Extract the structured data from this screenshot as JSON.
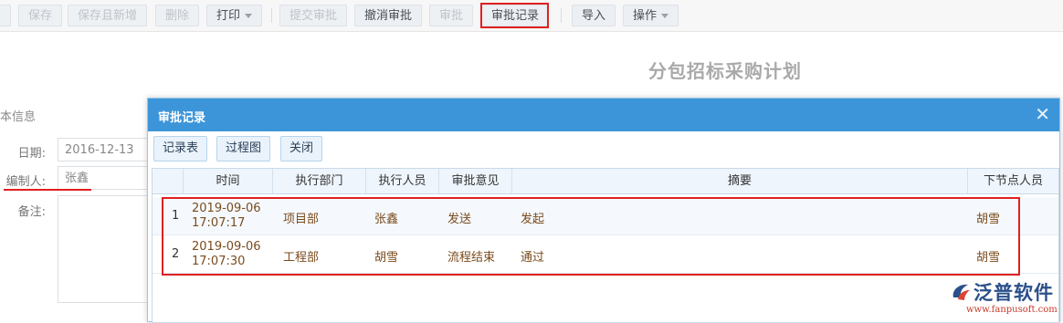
{
  "toolbar": {
    "buttons": [
      {
        "label": "保存"
      },
      {
        "label": "保存且新增"
      },
      {
        "label": "删除"
      },
      {
        "label": "打印"
      },
      {
        "label": "提交审批"
      },
      {
        "label": "撤消审批"
      },
      {
        "label": "审批"
      },
      {
        "label": "审批记录"
      },
      {
        "label": "导入"
      },
      {
        "label": "操作"
      }
    ]
  },
  "page": {
    "title": "分包招标采购计划"
  },
  "form": {
    "section_label": "本信息",
    "date_label": "日期:",
    "date_value": "2016-12-13",
    "editor_label": "编制人:",
    "editor_value": "张鑫",
    "remark_label": "备注:"
  },
  "dialog": {
    "title": "审批记录",
    "close_icon": "close-icon",
    "buttons": {
      "record_table": "记录表",
      "process_chart": "过程图",
      "close": "关闭"
    },
    "columns": [
      "时间",
      "执行部门",
      "执行人员",
      "审批意见",
      "摘要",
      "下节点人员"
    ],
    "rows": [
      {
        "index": "1",
        "date": "2019-09-06",
        "time": "17:07:17",
        "dept": "项目部",
        "person": "张鑫",
        "opinion": "发送",
        "summary": "发起",
        "next": "胡雪"
      },
      {
        "index": "2",
        "date": "2019-09-06",
        "time": "17:07:30",
        "dept": "工程部",
        "person": "胡雪",
        "opinion": "流程结束",
        "summary": "通过",
        "next": "胡雪"
      }
    ]
  },
  "logo": {
    "text": "泛普软件",
    "url": "www.fanpusoft.com"
  },
  "colors": {
    "accent": "#3d95d9",
    "highlight": "#e02020",
    "row_text": "#7a4b1c"
  }
}
